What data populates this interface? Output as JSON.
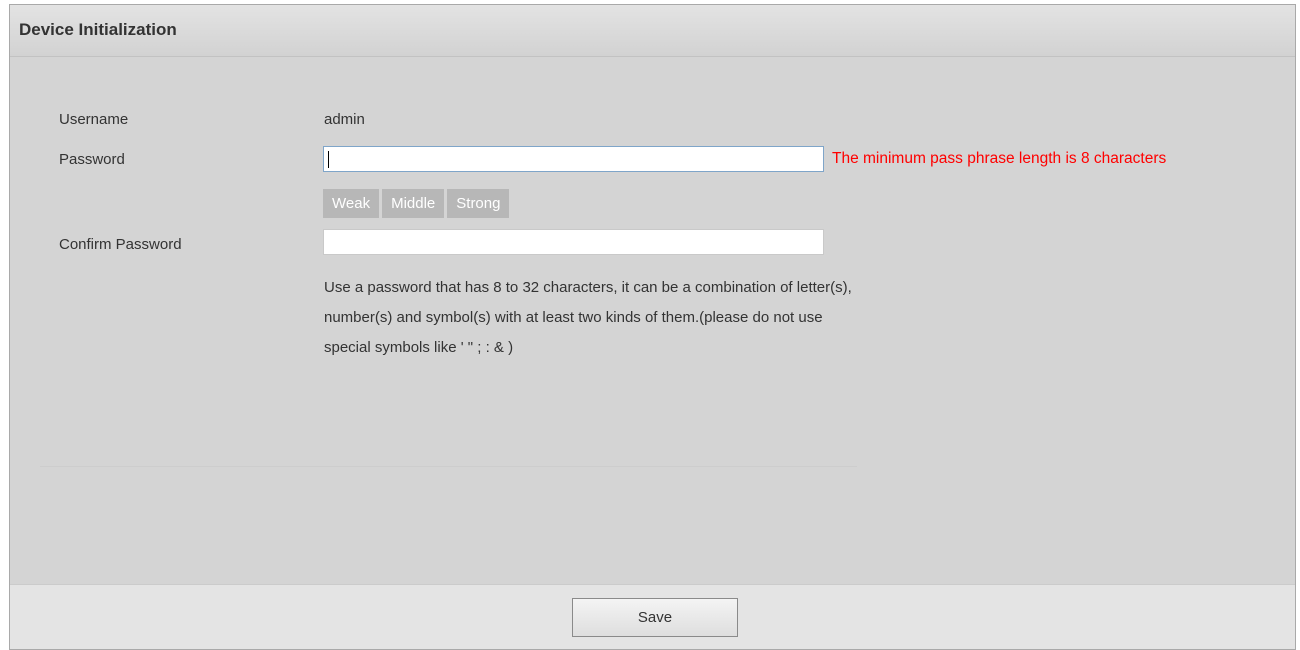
{
  "header": {
    "title": "Device Initialization"
  },
  "form": {
    "username_label": "Username",
    "username_value": "admin",
    "password_label": "Password",
    "password_value": "",
    "password_error": "The minimum pass phrase length is 8 characters",
    "strength": [
      "Weak",
      "Middle",
      "Strong"
    ],
    "confirm_label": "Confirm Password",
    "confirm_value": "",
    "hint_lines": [
      "Use a password that has 8 to 32 characters, it can be a combination of letter(s),",
      "number(s) and symbol(s) with at least two kinds of them.(please do not use",
      "special symbols like ' \" ; : & )"
    ]
  },
  "footer": {
    "save_label": "Save"
  },
  "colors": {
    "error": "#ff0000",
    "panel_bg": "#d4d4d4",
    "strength_bg": "#b7b7b7",
    "focus_border": "#7fa5c9"
  }
}
